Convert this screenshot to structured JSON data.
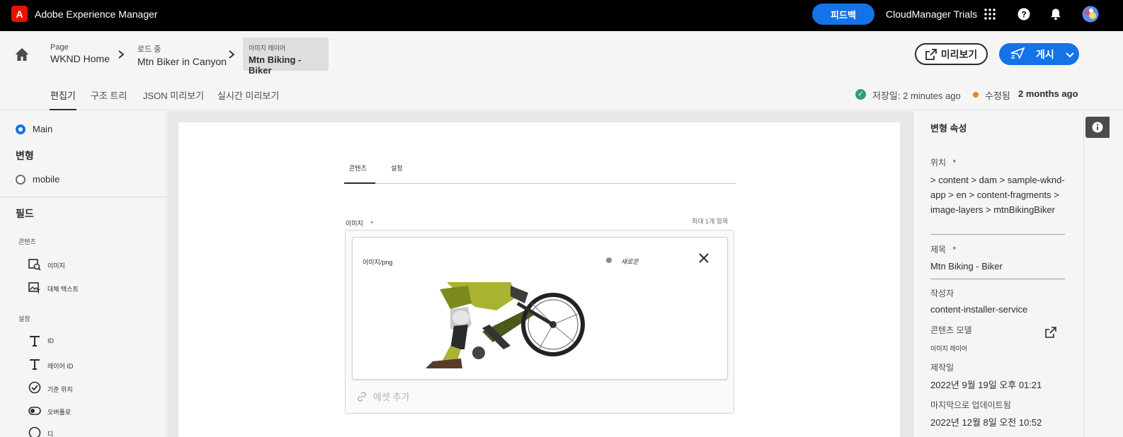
{
  "shell": {
    "logo_letter": "A",
    "app_title": "Adobe Experience Manager",
    "feedback_label": "피드백",
    "org_name": "CloudManager Trials"
  },
  "breadcrumbs": [
    {
      "small": "Page",
      "main": "WKND Home"
    },
    {
      "small": "로드 중",
      "main": "Mtn Biker in Canyon"
    },
    {
      "small": "이미지 레이어",
      "main": "Mtn Biking - Biker"
    }
  ],
  "actions": {
    "preview_label": "미리보기",
    "publish_label": "게시"
  },
  "tabs": [
    {
      "label": "편집기",
      "active": true
    },
    {
      "label": "구조 트리",
      "active": false
    },
    {
      "label": "JSON 미리보기",
      "active": false
    },
    {
      "label": "실시간 미리보기",
      "active": false
    }
  ],
  "status": {
    "saved_label": "저장일: 2 minutes ago",
    "modified_label": "수정됨",
    "modified_value": "2 months ago"
  },
  "left_panel": {
    "main_label": "Main",
    "variations_heading": "변형",
    "mobile_label": "mobile",
    "fields_heading": "필드",
    "content_group": "콘텐츠",
    "content_fields": [
      "이미지",
      "대체 텍스트"
    ],
    "settings_group": "설정",
    "settings_fields": [
      "ID",
      "레이어 ID",
      "기준 위치",
      "오버플로",
      "디"
    ]
  },
  "editor": {
    "form_tabs": [
      "콘텐츠",
      "설정"
    ],
    "image_field_label": "이미지",
    "required_mark": "*",
    "max_items": "최대 1개 항목",
    "asset_type": "이미지/png",
    "asset_status": "새로운",
    "add_asset_label": "에셋 추가"
  },
  "properties": {
    "title": "변형 속성",
    "location_label": "위치",
    "location_value": "> content > dam > sample-wknd-app > en > content-fragments > image-layers > mtnBikingBiker",
    "title_label": "제목",
    "title_value": "Mtn Biking - Biker",
    "author_label": "작성자",
    "author_value": "content-installer-service",
    "model_label": "콘텐츠 모델",
    "model_value": "이미지 레이어",
    "created_label": "제작일",
    "created_value": "2022년 9월 19일 오후 01:21",
    "updated_label": "마지막으로 업데이트됨",
    "updated_value": "2022년 12월 8일 오전 10:52"
  },
  "colors": {
    "accent": "#1473e6",
    "shell_bg": "#000000",
    "saved_ok": "#2d9d78",
    "modified_dot": "#e68619"
  }
}
